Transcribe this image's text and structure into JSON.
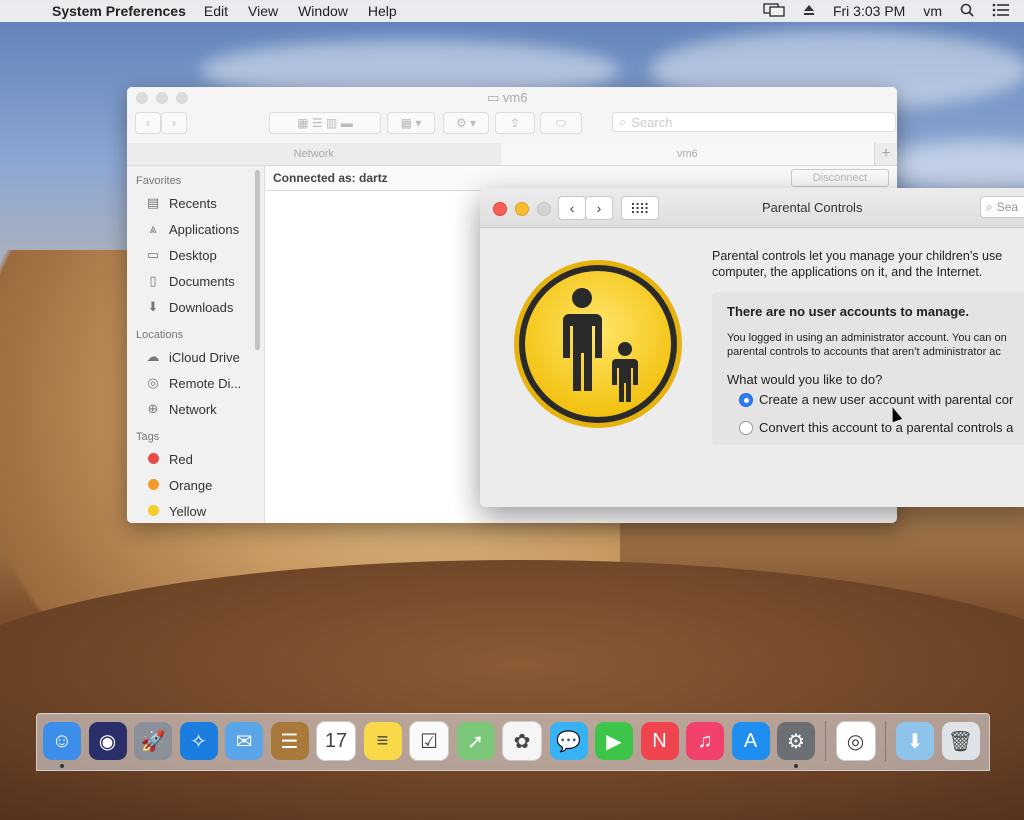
{
  "menubar": {
    "app_name": "System Preferences",
    "items": [
      "Edit",
      "View",
      "Window",
      "Help"
    ],
    "clock": "Fri 3:03 PM",
    "user": "vm"
  },
  "finder": {
    "title": "vm6",
    "search_placeholder": "Search",
    "tabs": [
      "Network",
      "vm6"
    ],
    "connected_label": "Connected as: dartz",
    "disconnect_label": "Disconnect",
    "sidebar": {
      "favorites_header": "Favorites",
      "favorites": [
        {
          "label": "Recents",
          "icon": "recents-icon"
        },
        {
          "label": "Applications",
          "icon": "applications-icon"
        },
        {
          "label": "Desktop",
          "icon": "desktop-icon"
        },
        {
          "label": "Documents",
          "icon": "documents-icon"
        },
        {
          "label": "Downloads",
          "icon": "downloads-icon"
        }
      ],
      "locations_header": "Locations",
      "locations": [
        {
          "label": "iCloud Drive",
          "icon": "cloud-icon"
        },
        {
          "label": "Remote Di...",
          "icon": "disc-icon"
        },
        {
          "label": "Network",
          "icon": "globe-icon"
        }
      ],
      "tags_header": "Tags",
      "tags": [
        {
          "label": "Red",
          "color": "#e84a4a"
        },
        {
          "label": "Orange",
          "color": "#f39a2c"
        },
        {
          "label": "Yellow",
          "color": "#f4cc2c"
        }
      ]
    }
  },
  "parental": {
    "title": "Parental Controls",
    "search_placeholder": "Sea",
    "description_line1": "Parental controls let you manage your children’s use",
    "description_line2": "computer, the applications on it, and the Internet.",
    "box_heading": "There are no user accounts to manage.",
    "box_msg_line1": "You logged in using an administrator account. You can on",
    "box_msg_line2": "parental controls to accounts that aren’t administrator ac",
    "question": "What would you like to do?",
    "option1": "Create a new user account with parental cor",
    "option2": "Convert this account to a parental controls a",
    "selected_option": 1
  },
  "dock": {
    "apps": [
      {
        "name": "Finder",
        "color": "#3d8ee8",
        "glyph": "☺",
        "running": true
      },
      {
        "name": "Siri",
        "color": "#2a2f6a",
        "glyph": "◉",
        "running": false
      },
      {
        "name": "Launchpad",
        "color": "#8a8f98",
        "glyph": "🚀",
        "running": false
      },
      {
        "name": "Safari",
        "color": "#1b7de0",
        "glyph": "✧",
        "running": false
      },
      {
        "name": "Mail",
        "color": "#5aa5e8",
        "glyph": "✉",
        "running": false
      },
      {
        "name": "Contacts",
        "color": "#a8793a",
        "glyph": "☰",
        "running": false
      },
      {
        "name": "Calendar",
        "color": "#ffffff",
        "glyph": "17",
        "running": false
      },
      {
        "name": "Notes",
        "color": "#f7d94a",
        "glyph": "≡",
        "running": false
      },
      {
        "name": "Reminders",
        "color": "#fafafa",
        "glyph": "☑",
        "running": false
      },
      {
        "name": "Maps",
        "color": "#7cc67a",
        "glyph": "➚",
        "running": false
      },
      {
        "name": "Photos",
        "color": "#f5f5f5",
        "glyph": "✿",
        "running": false
      },
      {
        "name": "Messages",
        "color": "#36b2f5",
        "glyph": "💬",
        "running": false
      },
      {
        "name": "FaceTime",
        "color": "#3dc54a",
        "glyph": "▶",
        "running": false
      },
      {
        "name": "News",
        "color": "#f0444e",
        "glyph": "N",
        "running": false
      },
      {
        "name": "Music",
        "color": "#f2416a",
        "glyph": "♫",
        "running": false
      },
      {
        "name": "App Store",
        "color": "#1e8ef0",
        "glyph": "A",
        "running": false
      },
      {
        "name": "System Preferences",
        "color": "#6b6e73",
        "glyph": "⚙",
        "running": true
      },
      {
        "name": "Chrome",
        "color": "#ffffff",
        "glyph": "◎",
        "running": false
      },
      {
        "name": "Downloads",
        "color": "#8ec3ea",
        "glyph": "⬇",
        "running": false
      },
      {
        "name": "Trash",
        "color": "#dfe3e8",
        "glyph": "🗑",
        "running": false
      }
    ]
  }
}
